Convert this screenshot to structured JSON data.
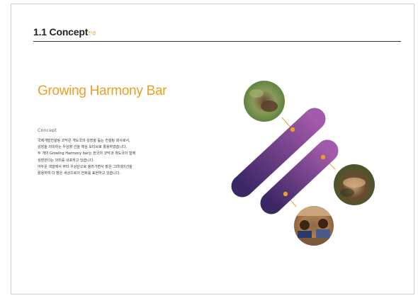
{
  "section": {
    "title": "1.1 Concept",
    "subtitle": "컨셉"
  },
  "main": {
    "title": "Growing  Harmony Bar",
    "concept_label": "Concept",
    "description_lines": [
      "국제개발컨설팅 코닥은 개도국의 성장을 돕는 컨설팅 회사로서,",
      "성장을 의미하는 우상향 선을 핵심 모티브로 활용하였습니다.",
      "두 개의 Growing Harmony bar는 한국의 코닥과 개도국이 함께",
      "성장한다는 의미를 내포하고 있습니다.",
      "어두운 색깔에서 부터 우상단으로 올라가면서 밝은 그라데이션을",
      "활용하여 더 밝은 세상으로의 전화를 표현하고 있습니다."
    ]
  },
  "colors": {
    "accent_orange": "#ec9f27",
    "bar_dark": "#3b2764",
    "bar_light": "#a35aa8",
    "frame_border": "#cfcfcf"
  },
  "photos": [
    {
      "name": "hands-planting-photo"
    },
    {
      "name": "hands-sharing-photo"
    },
    {
      "name": "children-classroom-photo"
    }
  ]
}
